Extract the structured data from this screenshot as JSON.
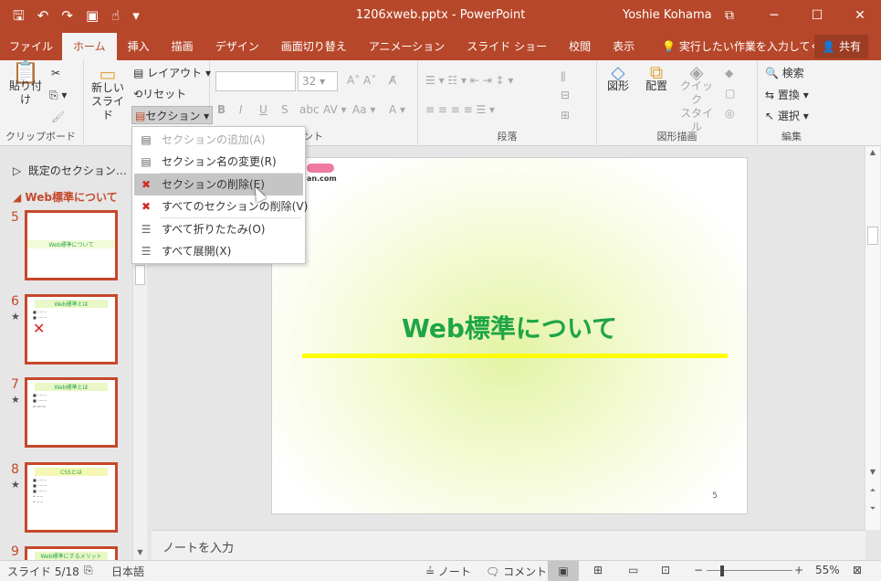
{
  "window": {
    "title": "1206xweb.pptx - PowerPoint",
    "user": "Yoshie Kohama",
    "controls": [
      "⧉",
      "─",
      "☐",
      "✕"
    ]
  },
  "qat_icons": [
    "save-icon",
    "undo-icon",
    "redo-icon",
    "present-icon",
    "touch-icon",
    "customize-icon"
  ],
  "tabs": [
    "ファイル",
    "ホーム",
    "挿入",
    "描画",
    "デザイン",
    "画面切り替え",
    "アニメーション",
    "スライド ショー",
    "校閲",
    "表示"
  ],
  "active_tab": "ホーム",
  "tell_me": "実行したい作業を入力してください",
  "share": "共有",
  "ribbon": {
    "clipboard": {
      "paste": "貼り付け",
      "label": "クリップボード"
    },
    "slides": {
      "new_slide": "新しい",
      "new_slide2": "スライド",
      "layout": "レイアウト",
      "reset": "リセット",
      "section": "セクション"
    },
    "font": {
      "size": "32",
      "label": "フォント"
    },
    "paragraph": {
      "label": "段落"
    },
    "drawing": {
      "shapes": "図形",
      "arrange": "配置",
      "quick": "クイック",
      "quick2": "スタイル",
      "label": "図形描画"
    },
    "editing": {
      "find": "検索",
      "replace": "置換",
      "select": "選択",
      "label": "編集"
    }
  },
  "section_menu": [
    {
      "label": "セクションの追加(A)",
      "disabled": true
    },
    {
      "label": "セクション名の変更(R)",
      "disabled": false
    },
    {
      "label": "セクションの削除(E)",
      "disabled": false,
      "hover": true
    },
    {
      "label": "すべてのセクションの削除(V)",
      "disabled": false
    },
    {
      "label": "すべて折りたたみ(O)",
      "disabled": false
    },
    {
      "label": "すべて展開(X)",
      "disabled": false
    }
  ],
  "thumbnails": {
    "default_section": "既定のセクション…",
    "web_section": "Web標準について",
    "slides": [
      {
        "num": "5",
        "title": "Web標準について"
      },
      {
        "num": "6",
        "title": "Web標準とは"
      },
      {
        "num": "7",
        "title": "Web標準とは"
      },
      {
        "num": "8",
        "title": "CSSとは"
      },
      {
        "num": "9",
        "title": "Web標準にするメリット"
      }
    ]
  },
  "slide": {
    "title": "Web標準について",
    "number": "5",
    "logo_text": "an.com"
  },
  "notes_placeholder": "ノートを入力",
  "status": {
    "slide": "スライド 5/18",
    "language": "日本語",
    "notes": "ノート",
    "comments": "コメント",
    "zoom": "55%"
  },
  "colors": {
    "accent": "#b7472a",
    "slide_title": "#1ea546",
    "underline": "#ffff00"
  }
}
